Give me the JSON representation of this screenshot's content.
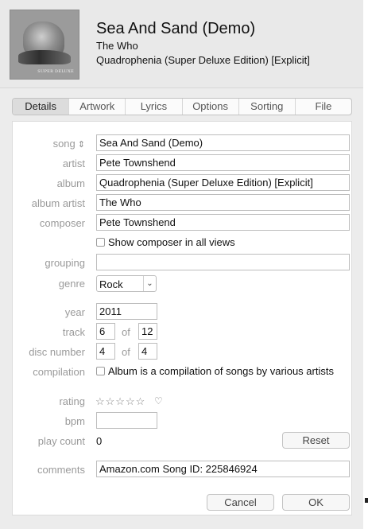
{
  "header": {
    "artwork_icon": "album-artwork",
    "artwork_caption": "SUPER DELUXE",
    "title": "Sea And Sand (Demo)",
    "artist": "The Who",
    "album": "Quadrophenia (Super Deluxe Edition) [Explicit]"
  },
  "tabs": [
    {
      "label": "Details"
    },
    {
      "label": "Artwork"
    },
    {
      "label": "Lyrics"
    },
    {
      "label": "Options"
    },
    {
      "label": "Sorting"
    },
    {
      "label": "File"
    }
  ],
  "labels": {
    "song": "song",
    "artist": "artist",
    "album": "album",
    "album_artist": "album artist",
    "composer": "composer",
    "grouping": "grouping",
    "genre": "genre",
    "year": "year",
    "track": "track",
    "disc_number": "disc number",
    "compilation": "compilation",
    "rating": "rating",
    "bpm": "bpm",
    "play_count": "play count",
    "comments": "comments",
    "of": "of"
  },
  "fields": {
    "song": "Sea And Sand (Demo)",
    "artist": "Pete Townshend",
    "album": "Quadrophenia (Super Deluxe Edition) [Explicit]",
    "album_artist": "The Who",
    "composer": "Pete Townshend",
    "show_composer_label": "Show composer in all views",
    "show_composer_checked": false,
    "grouping": "",
    "genre": "Rock",
    "year": "2011",
    "track_number": "6",
    "track_total": "12",
    "disc_number": "4",
    "disc_total": "4",
    "compilation_label": "Album is a compilation of songs by various artists",
    "compilation_checked": false,
    "rating_stars": "☆☆☆☆☆",
    "rating_value": 0,
    "love_icon": "♡",
    "bpm": "",
    "play_count": "0",
    "comments": "Amazon.com Song ID: 225846924"
  },
  "icons": {
    "sort": "⌃⌄",
    "chevron": "⌄"
  },
  "buttons": {
    "reset": "Reset",
    "cancel": "Cancel",
    "ok": "OK"
  }
}
